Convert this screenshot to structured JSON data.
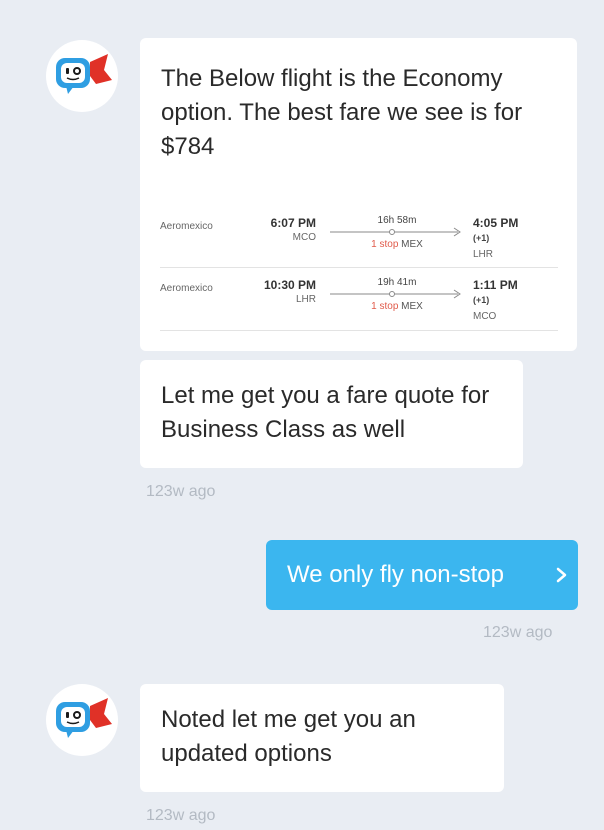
{
  "messages": {
    "m1": {
      "text": "The Below flight is the Economy option. The best fare we see is for $784"
    },
    "m2": {
      "text": "Let me get you a fare quote for Business Class as well",
      "time": "123w ago"
    },
    "m3": {
      "text": "We only fly non-stop",
      "time": "123w ago"
    },
    "m4": {
      "text": "Noted let me get you an updated options",
      "time": "123w ago"
    }
  },
  "flights": [
    {
      "airline": "Aeromexico",
      "dep_time": "6:07 PM",
      "dep_airport": "MCO",
      "duration": "16h 58m",
      "stop_count": "1 stop",
      "stop_airport": "MEX",
      "arr_time": "4:05 PM",
      "arr_offset": "(+1)",
      "arr_airport": "LHR"
    },
    {
      "airline": "Aeromexico",
      "dep_time": "10:30 PM",
      "dep_airport": "LHR",
      "duration": "19h 41m",
      "stop_count": "1 stop",
      "stop_airport": "MEX",
      "arr_time": "1:11 PM",
      "arr_offset": "(+1)",
      "arr_airport": "MCO"
    }
  ],
  "colors": {
    "background": "#e9edf3",
    "user_bubble": "#3bb6ef",
    "bot_bubble": "#ffffff",
    "stop_red": "#e05a4a",
    "avatar_blue": "#2f9ee2",
    "cape_red": "#e03127"
  },
  "icons": {
    "avatar": "bot-mascot-icon",
    "route": "flight-route-arrow-icon",
    "chevron": "chevron-right-icon"
  }
}
